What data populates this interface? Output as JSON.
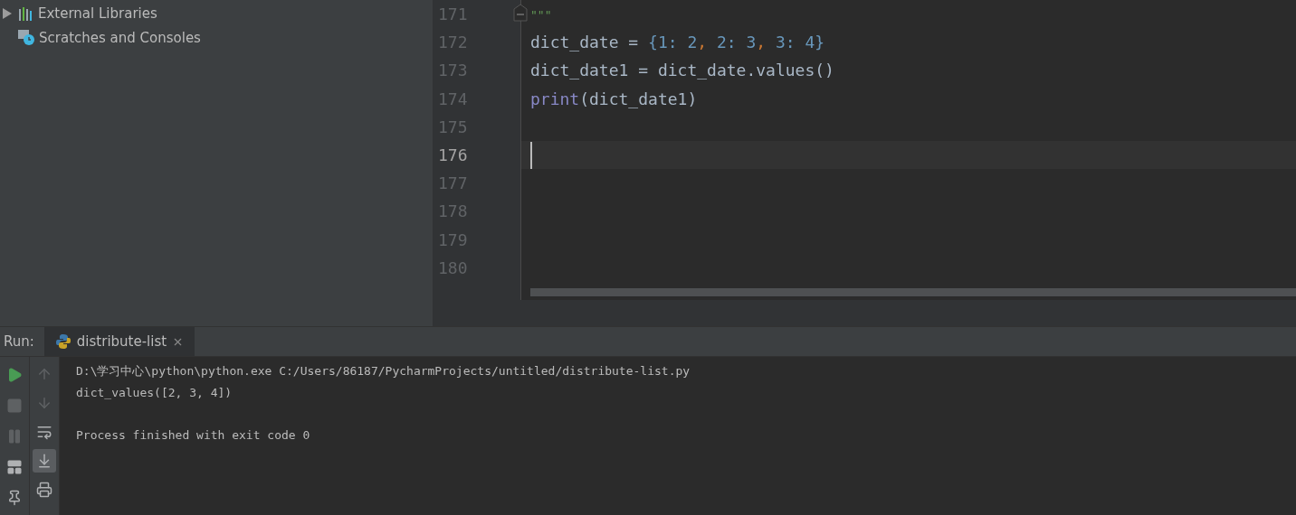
{
  "project_tree": {
    "items": [
      {
        "label": "External Libraries",
        "kind": "libraries",
        "expanded": false
      },
      {
        "label": "Scratches and Consoles",
        "kind": "scratches"
      }
    ]
  },
  "editor": {
    "lines": [
      {
        "number": "171",
        "current": false,
        "fold": true,
        "tokens": [
          {
            "text": "\"\"\"",
            "kind": "docstring"
          }
        ]
      },
      {
        "number": "172",
        "current": false,
        "tokens": [
          {
            "text": "dict_date = ",
            "kind": "ident"
          },
          {
            "text": "{1: 2",
            "kind": "number"
          },
          {
            "text": ", ",
            "kind": "comma"
          },
          {
            "text": "2: 3",
            "kind": "number"
          },
          {
            "text": ", ",
            "kind": "comma"
          },
          {
            "text": "3: 4}",
            "kind": "number"
          }
        ]
      },
      {
        "number": "173",
        "current": false,
        "tokens": [
          {
            "text": "dict_date1 = dict_date.values()",
            "kind": "ident"
          }
        ]
      },
      {
        "number": "174",
        "current": false,
        "tokens": [
          {
            "text": "print",
            "kind": "builtin"
          },
          {
            "text": "(dict_date1)",
            "kind": "ident"
          }
        ]
      },
      {
        "number": "175",
        "current": false
      },
      {
        "number": "176",
        "current": true
      },
      {
        "number": "177",
        "current": false
      },
      {
        "number": "178",
        "current": false
      },
      {
        "number": "179",
        "current": false
      },
      {
        "number": "180",
        "current": false
      }
    ]
  },
  "run_panel": {
    "label": "Run:",
    "tabs": [
      {
        "label": "distribute-list",
        "selected": true
      }
    ],
    "left_tools": [
      {
        "kind": "run"
      },
      {
        "kind": "stop"
      },
      {
        "kind": "pause"
      },
      {
        "kind": "layout"
      },
      {
        "kind": "pin"
      }
    ],
    "right_tools": [
      {
        "kind": "up",
        "on": false
      },
      {
        "kind": "down",
        "on": false
      },
      {
        "kind": "wrap",
        "on": false
      },
      {
        "kind": "scroll-end",
        "on": true
      },
      {
        "kind": "print",
        "on": false
      }
    ],
    "console": [
      {
        "text": "D:\\学习中心\\python\\python.exe C:/Users/86187/PycharmProjects/untitled/distribute-list.py",
        "blank_before": false
      },
      {
        "text": "dict_values([2, 3, 4])",
        "blank_before": false
      },
      {
        "text": "Process finished with exit code 0",
        "blank_before": true
      }
    ]
  }
}
